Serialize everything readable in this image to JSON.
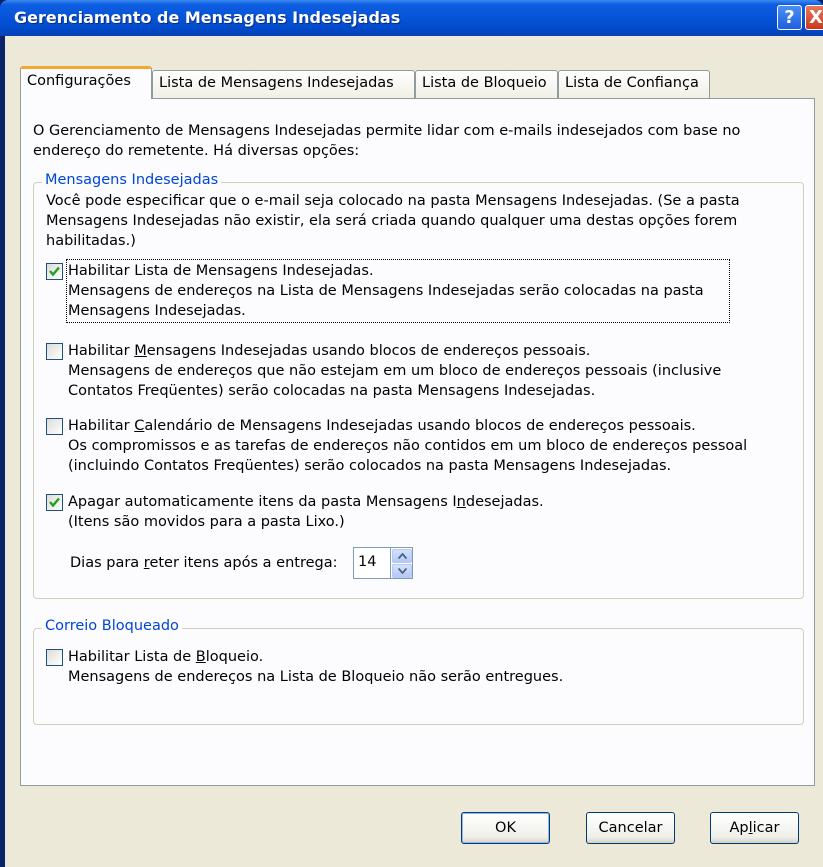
{
  "window": {
    "title": "Gerenciamento de Mensagens Indesejadas",
    "help_glyph": "?",
    "close_glyph": "X"
  },
  "tabs": [
    {
      "label": "Configurações",
      "active": true
    },
    {
      "label": "Lista de Mensagens Indesejadas",
      "active": false
    },
    {
      "label": "Lista de Bloqueio",
      "active": false
    },
    {
      "label": "Lista de Confiança",
      "active": false
    }
  ],
  "intro": "O Gerenciamento de Mensagens Indesejadas permite lidar com e-mails indesejados com base no endereço do remetente. Há diversas opções:",
  "junk_group": {
    "legend": "Mensagens Indesejadas",
    "description": "Você pode especificar que o e-mail seja colocado na pasta Mensagens Indesejadas. (Se a pasta Mensagens Indesejadas não existir, ela será criada quando qualquer uma destas opções forem habilitadas.)",
    "options": [
      {
        "label": "Habilitar Lista de Mensagens Indesejadas.",
        "detail_1": "Mensagens de endereços na Lista de Mensagens Indesejadas serão colocadas na pasta",
        "detail_2": "Mensagens Indesejadas.",
        "checked": true
      },
      {
        "label_pre": "Habilitar ",
        "label_u": "M",
        "label_post": "ensagens Indesejadas usando blocos de endereços pessoais.",
        "detail_1": "Mensagens de endereços que não estejam em um bloco de endereços pessoais (inclusive",
        "detail_2": "Contatos Freqüentes) serão colocadas na pasta Mensagens Indesejadas.",
        "checked": false
      },
      {
        "label_pre": "Habilitar ",
        "label_u": "C",
        "label_post": "alendário de Mensagens Indesejadas usando blocos de endereços pessoais.",
        "detail_1": "Os compromissos e as tarefas de endereços não contidos em um bloco de endereços pessoal",
        "detail_2": "(incluindo Contatos Freqüentes) serão colocados na pasta Mensagens Indesejadas.",
        "checked": false
      },
      {
        "label_pre": "Apagar automaticamente itens da pasta Mensagens I",
        "label_u": "n",
        "label_post": "desejadas.",
        "detail_1": "(Itens são movidos para a pasta Lixo.)",
        "checked": true
      }
    ],
    "days_label_pre": "Dias para ",
    "days_label_u": "r",
    "days_label_post": "eter itens após a entrega:",
    "days_value": "14"
  },
  "blocked_group": {
    "legend": "Correio Bloqueado",
    "label_pre": "Habilitar Lista de ",
    "label_u": "B",
    "label_post": "loqueio.",
    "detail": "Mensagens de endereços na Lista de Bloqueio não serão entregues.",
    "checked": false
  },
  "buttons": {
    "ok": "OK",
    "cancel": "Cancelar",
    "apply_pre": "Ap",
    "apply_u": "l",
    "apply_post": "icar"
  },
  "colors": {
    "title_bar": "#0553d7",
    "dialog_bg": "#ece9d8",
    "group_legend": "#0046d5",
    "active_tab_accent": "#f3a830",
    "checkmark": "#21a121"
  }
}
